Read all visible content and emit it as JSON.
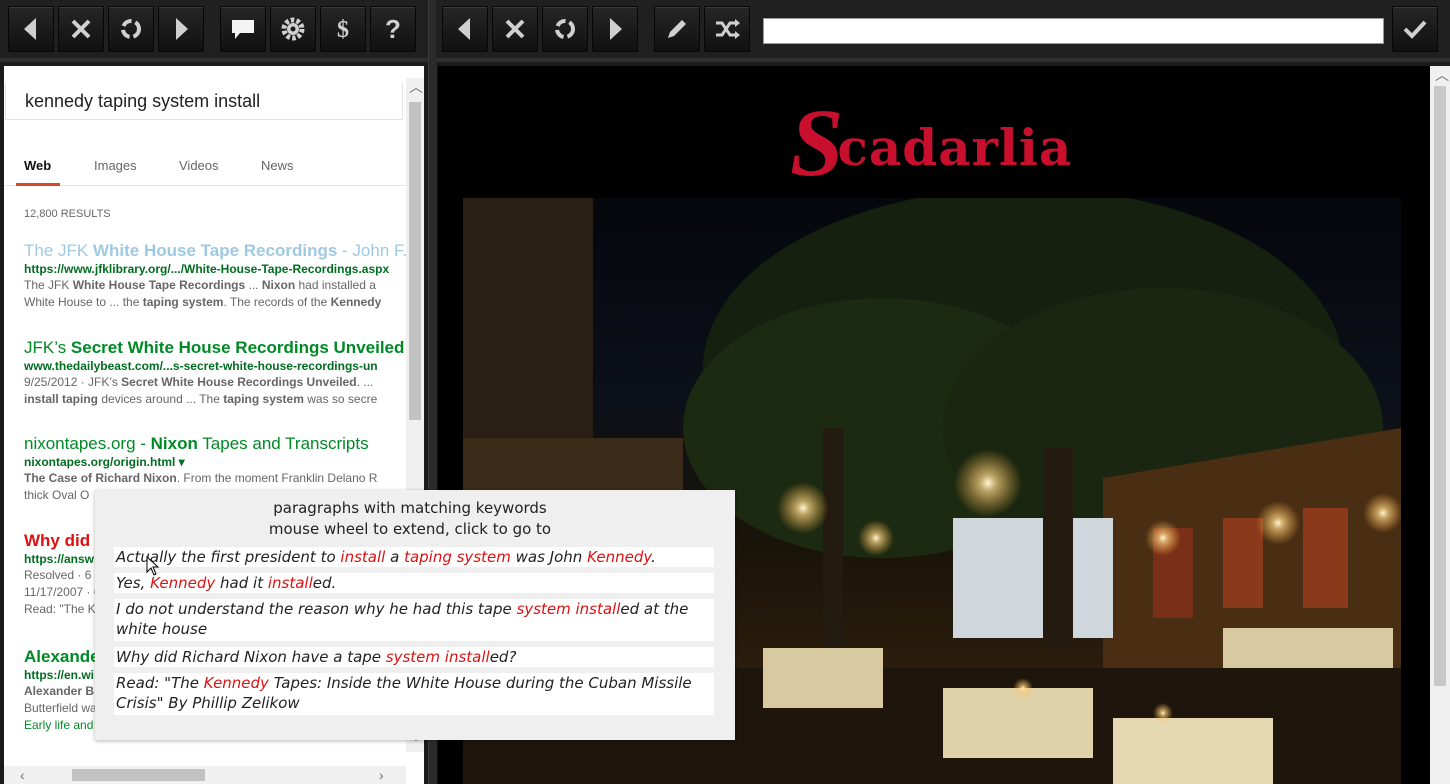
{
  "left_toolbar": {
    "buttons": [
      "back-icon",
      "close-icon",
      "reload-icon",
      "forward-icon",
      "speech-bubble-icon",
      "gear-icon",
      "dollar-s-icon",
      "question-icon"
    ]
  },
  "right_toolbar": {
    "buttons": [
      "back-icon",
      "close-icon",
      "reload-icon",
      "forward-icon",
      "pencil-icon",
      "shuffle-icon",
      "check-icon"
    ],
    "url_value": ""
  },
  "search": {
    "query": "kennedy taping system install",
    "tabs": [
      "Web",
      "Images",
      "Videos",
      "News"
    ],
    "active_tab": "Web",
    "results_count": "12,800 RESULTS",
    "results": [
      {
        "title_parts": [
          {
            "t": "The JFK ",
            "b": false
          },
          {
            "t": "White House Tape Recordings",
            "b": true
          },
          {
            "t": " - John F.",
            "b": false
          }
        ],
        "title_color": "#9ec9e2",
        "url_parts": [
          {
            "t": "https://",
            "b": false
          },
          {
            "t": "www.jfklibrary.org/.../White-House-Tape-Recordings.aspx",
            "b": true
          }
        ],
        "snip1_parts": [
          {
            "t": "The JFK ",
            "b": false
          },
          {
            "t": "White House Tape Recordings",
            "b": true
          },
          {
            "t": " ... ",
            "b": false
          },
          {
            "t": "Nixon",
            "b": true
          },
          {
            "t": " had installed a",
            "b": false
          }
        ],
        "snip2_parts": [
          {
            "t": "White House to ... the ",
            "b": false
          },
          {
            "t": "taping system",
            "b": true
          },
          {
            "t": ". The records of the ",
            "b": false
          },
          {
            "t": "Kennedy",
            "b": true
          }
        ]
      },
      {
        "title_parts": [
          {
            "t": "JFK’s ",
            "b": false
          },
          {
            "t": "Secret White House Recordings Unveiled",
            "b": true
          }
        ],
        "title_color": "#008a25",
        "url_parts": [
          {
            "t": "www.thedailybeast.com/...s-secret-white-house-recordings-un",
            "b": true
          }
        ],
        "snip1_parts": [
          {
            "t": "9/25/2012 · JFK’s ",
            "b": false
          },
          {
            "t": "Secret White House Recordings Unveiled",
            "b": true
          },
          {
            "t": ". ...",
            "b": false
          }
        ],
        "snip2_parts": [
          {
            "t": "install taping",
            "b": true
          },
          {
            "t": " devices around ... The ",
            "b": false
          },
          {
            "t": "taping system",
            "b": true
          },
          {
            "t": " was so secre",
            "b": false
          }
        ]
      },
      {
        "title_parts": [
          {
            "t": "nixontapes.org - ",
            "b": false
          },
          {
            "t": "Nixon",
            "b": true
          },
          {
            "t": " Tapes and Transcripts",
            "b": false
          }
        ],
        "title_color": "#008a25",
        "url_parts": [
          {
            "t": "nixon",
            "b": true
          },
          {
            "t": "tapes.org/origin.html ▾",
            "b": false
          }
        ],
        "snip1_parts": [
          {
            "t": "The Case of Richard Nixon",
            "b": true
          },
          {
            "t": ". From the moment Franklin Delano R",
            "b": false
          }
        ],
        "snip2_parts": [
          {
            "t": "thick Oval O",
            "b": false
          }
        ]
      },
      {
        "title_parts": [
          {
            "t": "Why did",
            "b": true
          }
        ],
        "title_color": "#d11",
        "url_parts": [
          {
            "t": "https://answ",
            "b": true
          }
        ],
        "snip1_parts": [
          {
            "t": "Resolved · 6",
            "b": false
          }
        ],
        "snip2_parts": [
          {
            "t": "11/17/2007 · 6",
            "b": false
          }
        ],
        "snip3_parts": [
          {
            "t": "Read: \"The K",
            "b": false
          }
        ]
      },
      {
        "title_parts": [
          {
            "t": "Alexande",
            "b": true
          }
        ],
        "title_color": "#008a25",
        "url_parts": [
          {
            "t": "https://en.wi",
            "b": true
          }
        ],
        "snip1_parts": [
          {
            "t": "Alexander B",
            "b": true
          }
        ],
        "snip2_parts": [
          {
            "t": "Butterfield wa",
            "b": false
          }
        ],
        "snip3_parts": [
          {
            "t": "Early life and",
            "b": false
          }
        ]
      }
    ]
  },
  "popup": {
    "heading1": "paragraphs with matching keywords",
    "heading2": "mouse wheel to extend, click to go to",
    "paragraphs": [
      [
        {
          "t": "Actually the first president to ",
          "k": false
        },
        {
          "t": "install",
          "k": true
        },
        {
          "t": " a ",
          "k": false
        },
        {
          "t": "taping system",
          "k": true
        },
        {
          "t": " was John ",
          "k": false
        },
        {
          "t": "Kennedy",
          "k": true
        },
        {
          "t": ".",
          "k": false
        }
      ],
      [
        {
          "t": "Yes, ",
          "k": false
        },
        {
          "t": "Kennedy",
          "k": true
        },
        {
          "t": " had it ",
          "k": false
        },
        {
          "t": "install",
          "k": true
        },
        {
          "t": "ed.",
          "k": false
        }
      ],
      [
        {
          "t": "I do not understand the reason why he had this tape ",
          "k": false
        },
        {
          "t": "system install",
          "k": true
        },
        {
          "t": "ed at the white house",
          "k": false
        }
      ],
      [
        {
          "t": "Why did Richard Nixon have a tape ",
          "k": false
        },
        {
          "t": "system install",
          "k": true
        },
        {
          "t": "ed?",
          "k": false
        }
      ],
      [
        {
          "t": "Read: \"The ",
          "k": false
        },
        {
          "t": "Kennedy",
          "k": true
        },
        {
          "t": " Tapes: Inside the White House during the Cuban Missile Crisis\" By Phillip Zelikow",
          "k": false
        }
      ]
    ]
  },
  "site": {
    "logo_initial": "S",
    "logo_rest": "cadarlia",
    "brand_color": "#c8102e"
  }
}
